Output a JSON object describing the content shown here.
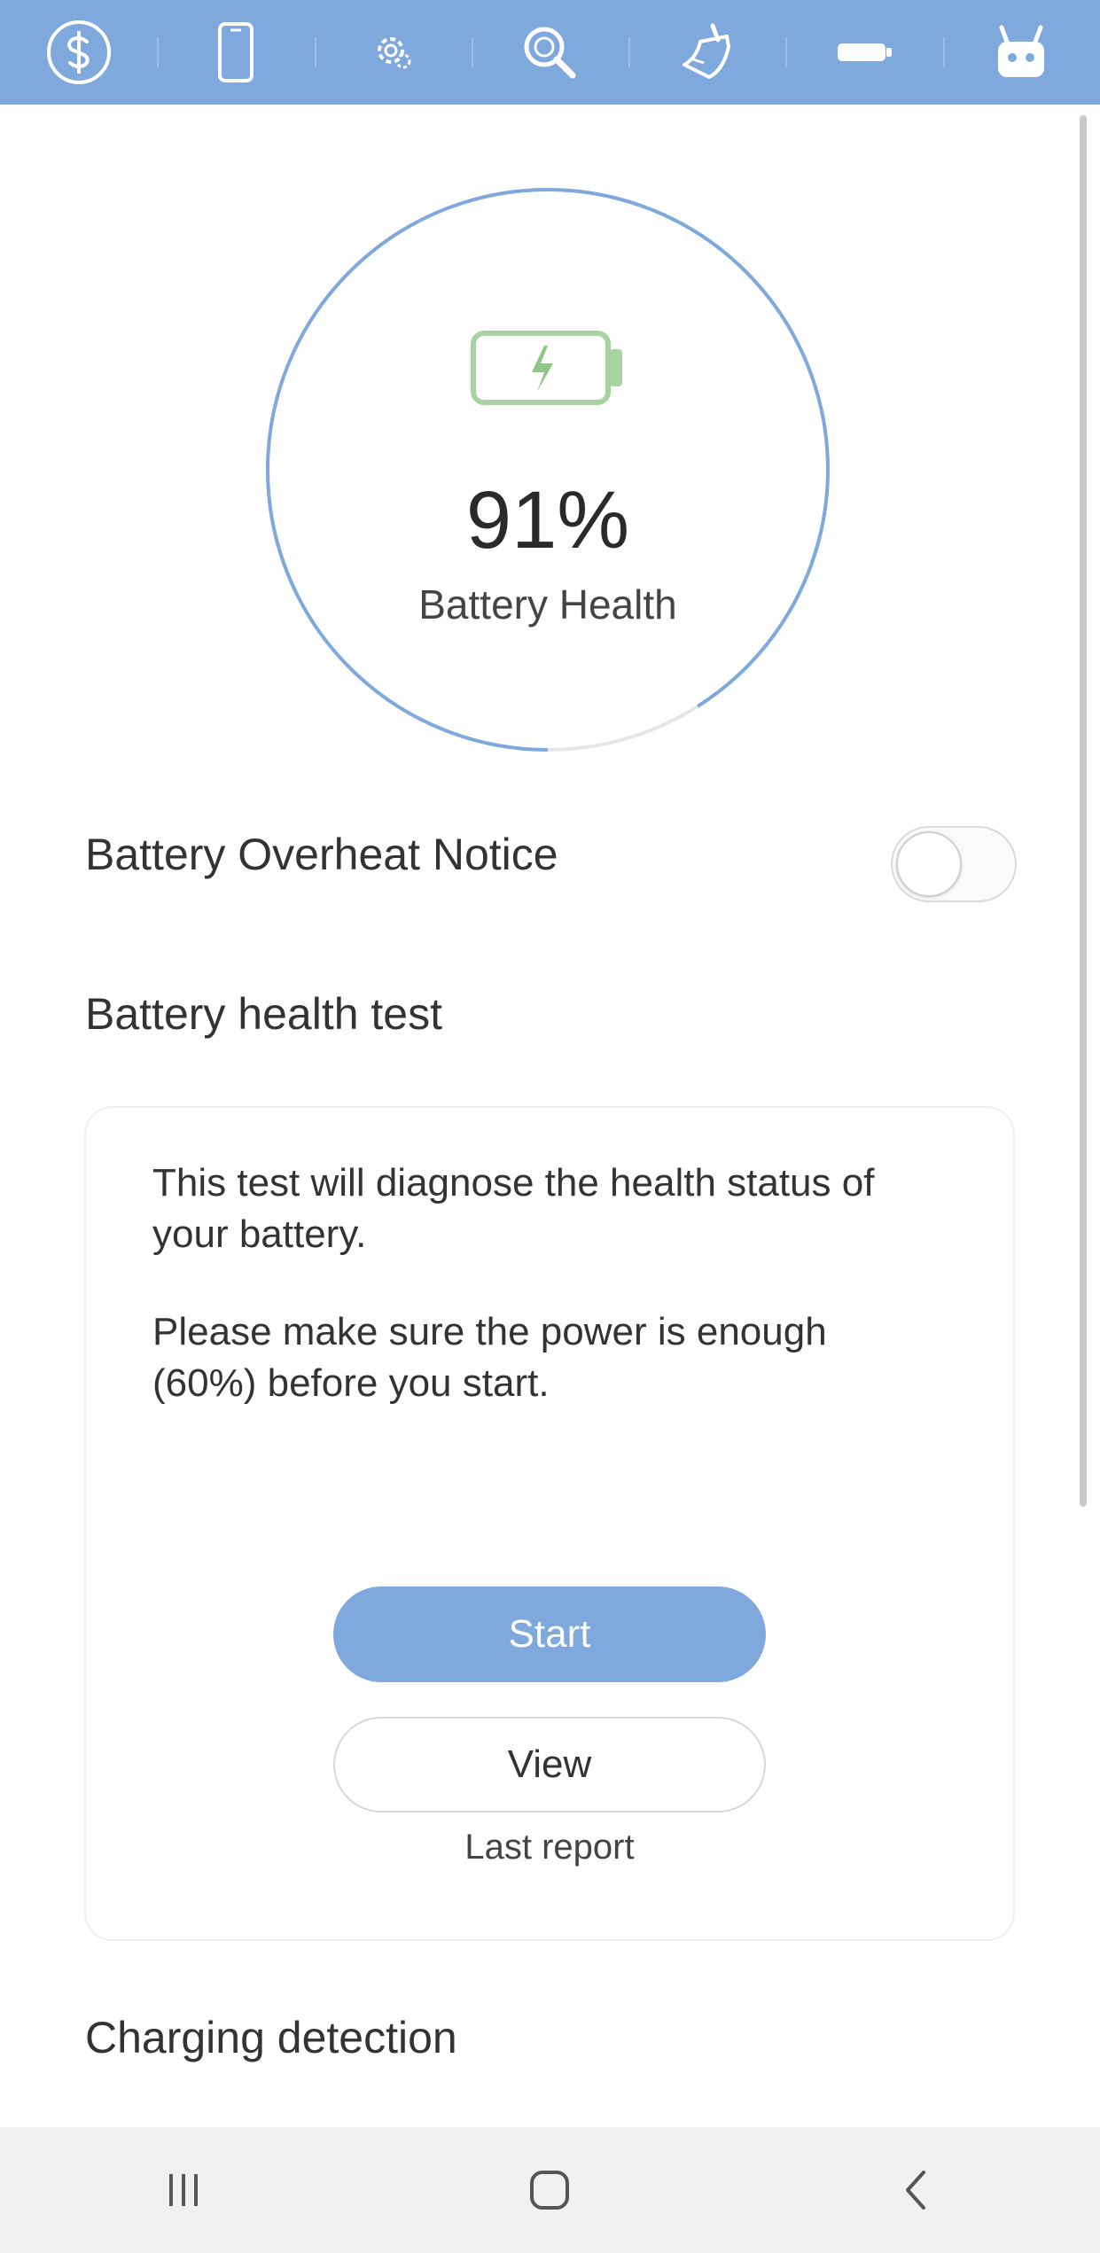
{
  "toolbar": {
    "items": [
      {
        "name": "dollar-icon"
      },
      {
        "name": "phone-icon"
      },
      {
        "name": "gear-icon"
      },
      {
        "name": "search-icon"
      },
      {
        "name": "cleaner-icon"
      },
      {
        "name": "battery-icon"
      },
      {
        "name": "robot-icon"
      }
    ]
  },
  "battery": {
    "percent_label": "91%",
    "health_label": "Battery Health",
    "health_fraction": 0.91
  },
  "overheat": {
    "label": "Battery Overheat Notice",
    "enabled": false
  },
  "health_test": {
    "section_title": "Battery health test",
    "description_1": "This test will diagnose the health status of your battery.",
    "description_2": "Please make sure the power is enough (60%) before you start.",
    "start_label": "Start",
    "view_label": "View",
    "last_report_label": "Last report"
  },
  "charging": {
    "section_title": "Charging detection"
  },
  "colors": {
    "accent": "#7fa8dd",
    "battery_green": "#8fc785",
    "ring_track": "#e6e6e6"
  },
  "navbar": {
    "items": [
      {
        "name": "recent-apps-icon"
      },
      {
        "name": "home-icon"
      },
      {
        "name": "back-icon"
      }
    ]
  }
}
